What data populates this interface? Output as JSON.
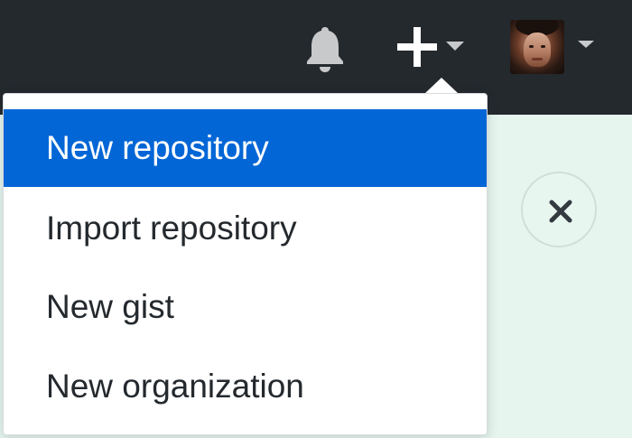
{
  "header": {
    "notifications_icon": "bell-icon",
    "create_menu_icon": "plus-icon",
    "avatar_alt": "user-avatar"
  },
  "create_menu": {
    "items": [
      {
        "label": "New repository",
        "active": true
      },
      {
        "label": "Import repository",
        "active": false
      },
      {
        "label": "New gist",
        "active": false
      },
      {
        "label": "New organization",
        "active": false
      }
    ]
  },
  "banner": {
    "close_icon": "close-icon"
  },
  "colors": {
    "header_bg": "#24292e",
    "menu_active_bg": "#0366d6",
    "menu_text": "#24292e",
    "page_bg": "#e6f6ef",
    "icon_gray": "#c8c9cb"
  }
}
